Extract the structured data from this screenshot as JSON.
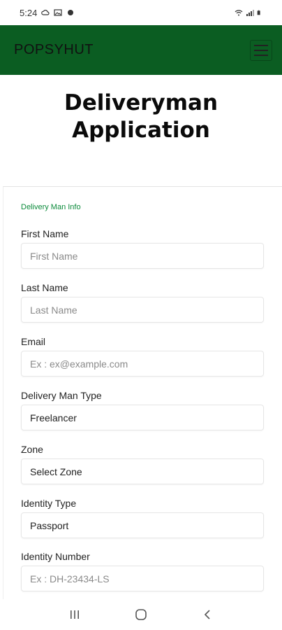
{
  "status_bar": {
    "time": "5:24",
    "icons_left": [
      "cloud-icon",
      "image-icon",
      "app-icon"
    ],
    "icons_right": [
      "wifi-icon",
      "signal-icon",
      "battery-icon"
    ]
  },
  "header": {
    "brand": "POPSYHUT",
    "background": "#0b5d22"
  },
  "page": {
    "title_line1": "Deliveryman",
    "title_line2": "Application"
  },
  "form": {
    "section_label": "Delivery Man Info",
    "fields": [
      {
        "label": "First Name",
        "placeholder": "First Name",
        "value": ""
      },
      {
        "label": "Last Name",
        "placeholder": "Last Name",
        "value": ""
      },
      {
        "label": "Email",
        "placeholder": "Ex : ex@example.com",
        "value": ""
      },
      {
        "label": "Delivery Man Type",
        "placeholder": "",
        "value": "Freelancer"
      },
      {
        "label": "Zone",
        "placeholder": "",
        "value": "Select Zone"
      },
      {
        "label": "Identity Type",
        "placeholder": "",
        "value": "Passport"
      },
      {
        "label": "Identity Number",
        "placeholder": "Ex : DH-23434-LS",
        "value": ""
      }
    ]
  },
  "nav_bar": {
    "buttons": [
      "recent-apps-icon",
      "home-icon",
      "back-icon"
    ]
  }
}
